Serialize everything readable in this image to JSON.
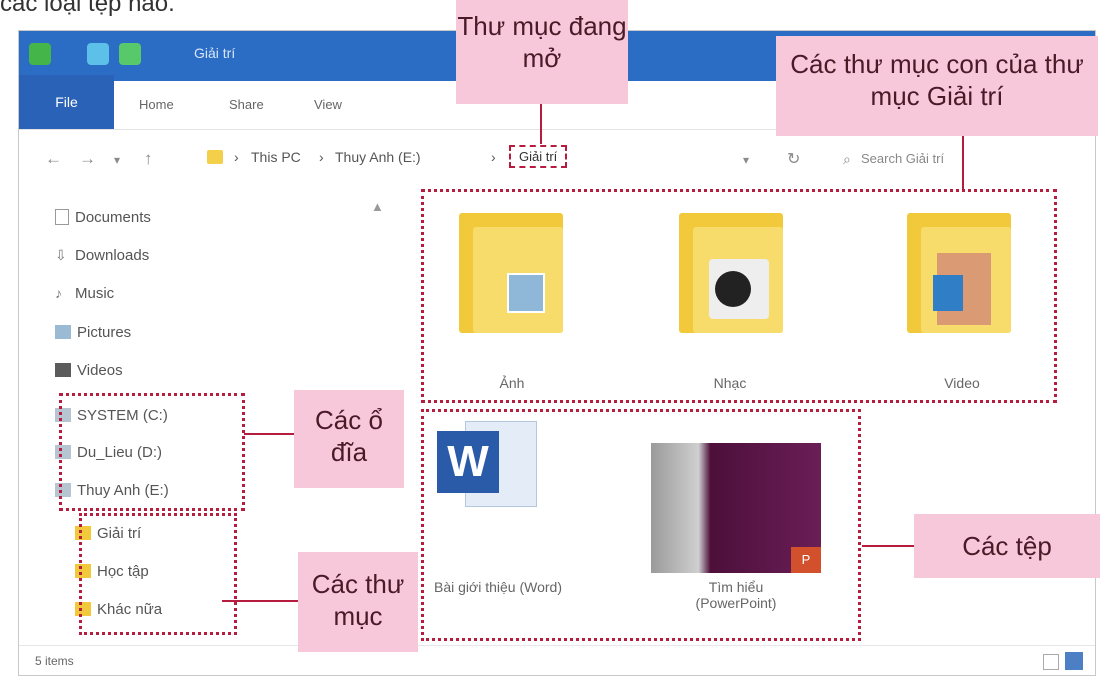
{
  "top_caption": "các loại tệp nào.",
  "window": {
    "title": "Giải trí",
    "tabs": [
      "File",
      "Home",
      "Share",
      "View"
    ]
  },
  "address_bar": {
    "crumbs": [
      "This PC",
      "Thuy Anh (E:)"
    ],
    "current": "Giải trí",
    "search_placeholder": "Search Giải trí"
  },
  "nav_pane": {
    "items": [
      {
        "label": "Documents",
        "icon": "documents-icon"
      },
      {
        "label": "Downloads",
        "icon": "downloads-icon"
      },
      {
        "label": "Music",
        "icon": "music-icon"
      },
      {
        "label": "Pictures",
        "icon": "pictures-icon"
      },
      {
        "label": "Videos",
        "icon": "videos-icon"
      }
    ],
    "drives": [
      {
        "label": "SYSTEM (C:)",
        "icon": "drive-icon"
      },
      {
        "label": "Du_Lieu (D:)",
        "icon": "drive-icon"
      },
      {
        "label": "Thuy Anh (E:)",
        "icon": "drive-icon"
      }
    ],
    "folders": [
      {
        "label": "Giải trí",
        "icon": "folder-icon"
      },
      {
        "label": "Học tập",
        "icon": "folder-icon"
      },
      {
        "label": "Khác nữa",
        "icon": "folder-icon"
      }
    ]
  },
  "content": {
    "subfolders": [
      {
        "label": "Ảnh",
        "icon": "folder-photos-icon"
      },
      {
        "label": "Nhạc",
        "icon": "folder-music-icon"
      },
      {
        "label": "Video",
        "icon": "folder-video-icon"
      }
    ],
    "files": [
      {
        "label": "Bài giới thiệu (Word)",
        "icon": "word-icon"
      },
      {
        "label": "Tìm hiểu (PowerPoint)",
        "icon": "powerpoint-icon"
      }
    ]
  },
  "status_bar": {
    "text": "5 items"
  },
  "callouts": {
    "open_folder": "Thư mục đang mở",
    "subfolders": "Các thư mục con của thư mục Giải trí",
    "drives": "Các ổ đĩa",
    "files": "Các tệp",
    "folders": "Các thư mục"
  },
  "colors": {
    "accent": "#2b6cc4",
    "highlight": "#b51c3e",
    "callout_bg": "#f7c8d9",
    "folder_yellow": "#f3c93c"
  }
}
